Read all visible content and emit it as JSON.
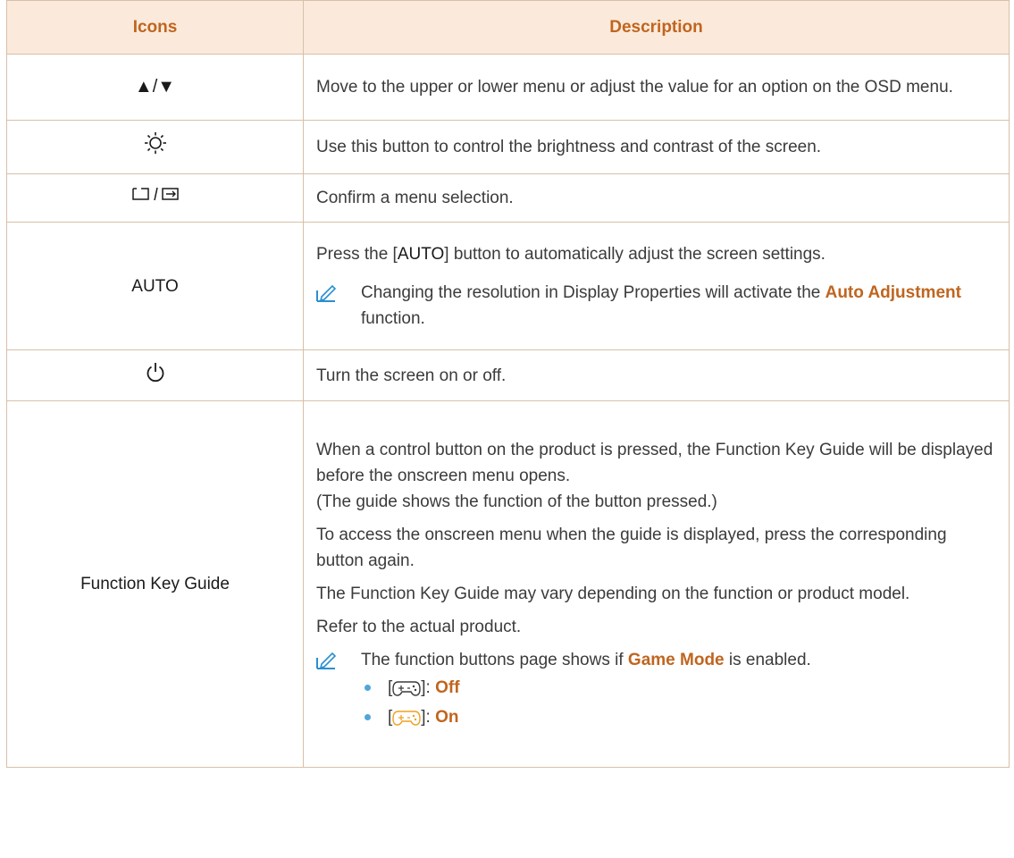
{
  "table": {
    "headers": {
      "icons": "Icons",
      "description": "Description"
    },
    "rows": {
      "updown": {
        "icon": "▲/▼",
        "text": "Move to the upper or lower menu or adjust the value for an option on the OSD menu."
      },
      "brightness": {
        "icon_name": "brightness-icon",
        "text": "Use this button to control the brightness and contrast of the screen."
      },
      "menu_source": {
        "icon_name": "menu-enter-icon",
        "text": "Confirm a menu selection."
      },
      "auto": {
        "icon": "AUTO",
        "text_pre": "Press the [",
        "text_key": "AUTO",
        "text_post": "] button to automatically adjust the screen settings.",
        "note_pre": "Changing the resolution in Display Properties will activate the ",
        "note_highlight": "Auto Adjustment",
        "note_post": " function."
      },
      "power": {
        "icon_name": "power-icon",
        "text": "Turn the screen on or off."
      },
      "guide": {
        "icon": "Function Key Guide",
        "para1": "When a control button on the product is pressed, the Function Key Guide will be displayed before the onscreen menu opens.",
        "para1b": "(The guide shows the function of the button pressed.)",
        "para2": "To access the onscreen menu when the guide is displayed, press the corresponding button again.",
        "para3": "The Function Key Guide may vary depending on the function or product model.",
        "para4": "Refer to the actual product.",
        "note_pre": "The function buttons page shows if ",
        "note_highlight": "Game Mode",
        "note_post": " is enabled.",
        "bullets": [
          {
            "open": "[",
            "close": "]: ",
            "state": "Off"
          },
          {
            "open": "[",
            "close": "]: ",
            "state": "On"
          }
        ]
      }
    }
  },
  "colors": {
    "header_bg": "#fbeadb",
    "header_text": "#c0651f",
    "border": "#d8c0a8",
    "highlight": "#c0651f",
    "note_icon": "#2a8fd0",
    "bullet": "#4fa6da",
    "gamepad_on": "#f0a020"
  }
}
